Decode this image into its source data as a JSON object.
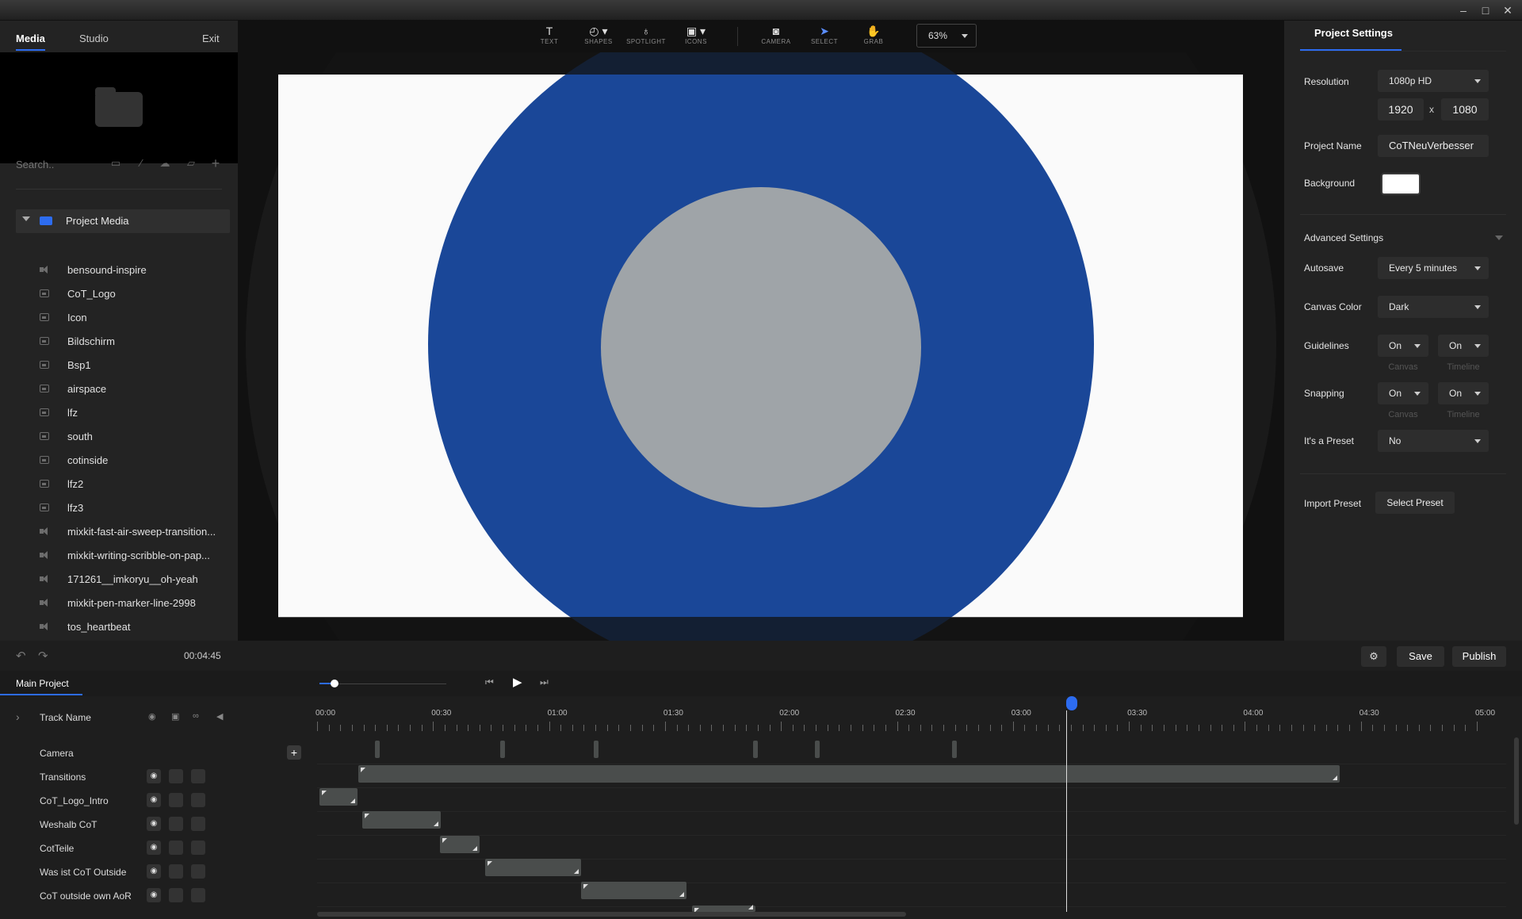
{
  "left_tabs": {
    "media": "Media",
    "studio": "Studio",
    "exit": "Exit"
  },
  "search": {
    "placeholder": "Search.."
  },
  "project_media": {
    "label": "Project Media",
    "items": [
      {
        "name": "bensound-inspire",
        "type": "audio"
      },
      {
        "name": "CoT_Logo",
        "type": "image"
      },
      {
        "name": "Icon",
        "type": "image"
      },
      {
        "name": "Bildschirm",
        "type": "image"
      },
      {
        "name": "Bsp1",
        "type": "image"
      },
      {
        "name": "airspace",
        "type": "image"
      },
      {
        "name": "lfz",
        "type": "image"
      },
      {
        "name": "south",
        "type": "image"
      },
      {
        "name": "cotinside",
        "type": "image"
      },
      {
        "name": "lfz2",
        "type": "image"
      },
      {
        "name": "lfz3",
        "type": "image"
      },
      {
        "name": "mixkit-fast-air-sweep-transition...",
        "type": "audio"
      },
      {
        "name": "mixkit-writing-scribble-on-pap...",
        "type": "audio"
      },
      {
        "name": "171261__imkoryu__oh-yeah",
        "type": "audio"
      },
      {
        "name": "mixkit-pen-marker-line-2998",
        "type": "audio"
      },
      {
        "name": "tos_heartbeat",
        "type": "audio"
      }
    ]
  },
  "toolbar": {
    "tools": [
      {
        "label": "TEXT",
        "icon": "text-icon",
        "glyph": "T"
      },
      {
        "label": "SHAPES",
        "icon": "shapes-icon",
        "glyph": "◴ ▾"
      },
      {
        "label": "SPOTLIGHT",
        "icon": "spotlight-icon",
        "glyph": "♁"
      },
      {
        "label": "ICONS",
        "icon": "icons-icon",
        "glyph": "▣ ▾"
      },
      {
        "label": "CAMERA",
        "icon": "camera-icon",
        "glyph": "◙"
      },
      {
        "label": "SELECT",
        "icon": "select-icon",
        "glyph": "➤"
      },
      {
        "label": "GRAB",
        "icon": "grab-icon",
        "glyph": "✋"
      }
    ],
    "zoom": "63%"
  },
  "colors": {
    "accent": "#2d6cf0",
    "big_circle": "#1a4798",
    "inner_circle": "#9fa4a8",
    "canvas_bg": "#fafafa"
  },
  "settings": {
    "title": "Project Settings",
    "resolution_label": "Resolution",
    "resolution": "1080p HD",
    "width": "1920",
    "x": "x",
    "height": "1080",
    "project_name_label": "Project Name",
    "project_name": "CoTNeuVerbesser",
    "background_label": "Background",
    "advanced_label": "Advanced Settings",
    "autosave_label": "Autosave",
    "autosave": "Every 5 minutes",
    "canvas_color_label": "Canvas Color",
    "canvas_color": "Dark",
    "guidelines_label": "Guidelines",
    "guidelines_canvas": "On",
    "guidelines_timeline": "On",
    "snapping_label": "Snapping",
    "snapping_canvas": "On",
    "snapping_timeline": "On",
    "sub_canvas": "Canvas",
    "sub_timeline": "Timeline",
    "preset_label": "It's a Preset",
    "preset": "No",
    "import_label": "Import Preset",
    "select_preset": "Select Preset"
  },
  "controls": {
    "duration": "00:04:45",
    "save": "Save",
    "publish": "Publish"
  },
  "timeline": {
    "tab": "Main Project",
    "header": "Track Name",
    "ruler": [
      "00:00",
      "00:30",
      "01:00",
      "01:30",
      "02:00",
      "02:30",
      "03:00",
      "03:30",
      "04:00",
      "04:30",
      "05:00"
    ],
    "tracks": [
      "Camera",
      "Transitions",
      "CoT_Logo_Intro",
      "Weshalb CoT",
      "CotTeile",
      "Was ist CoT Outside",
      "CoT outside own AoR"
    ]
  }
}
